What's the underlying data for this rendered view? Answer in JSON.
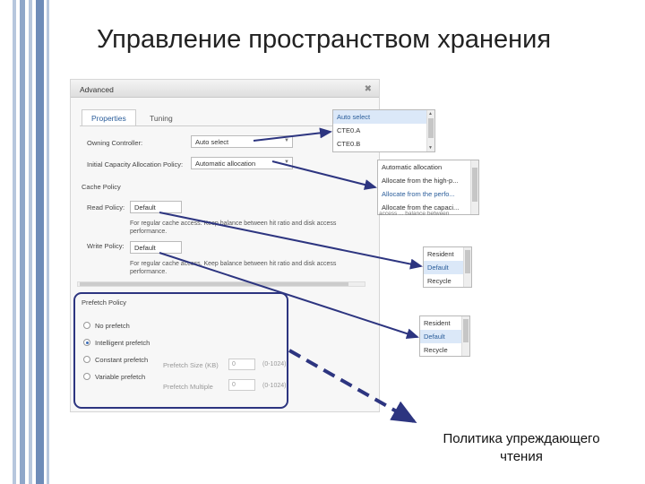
{
  "slide": {
    "title": "Управление пространством хранения",
    "callout": [
      "Политика упреждающего",
      "чтения"
    ]
  },
  "dialog": {
    "title": "Advanced",
    "tabs": [
      {
        "label": "Properties",
        "active": true
      },
      {
        "label": "Tuning",
        "active": false
      }
    ],
    "owning_controller": {
      "label": "Owning Controller:",
      "value": "Auto select"
    },
    "initial_capacity": {
      "label": "Initial Capacity Allocation Policy:",
      "value": "Automatic allocation"
    },
    "cache_policy": {
      "heading": "Cache Policy",
      "read": {
        "label": "Read Policy:",
        "value": "Default",
        "desc": "For regular cache access. Keep balance between hit ratio and disk access performance."
      },
      "write": {
        "label": "Write Policy:",
        "value": "Default",
        "desc": "For regular cache access. Keep balance between hit ratio and disk access performance."
      }
    },
    "prefetch_policy": {
      "heading": "Prefetch Policy",
      "options": [
        "No prefetch",
        "Intelligent prefetch",
        "Constant prefetch",
        "Variable prefetch"
      ],
      "selected": "Intelligent prefetch",
      "size": {
        "label": "Prefetch Size (KB)",
        "value": "0",
        "range": "(0-1024)"
      },
      "multiple": {
        "label": "Prefetch Multiple",
        "value": "0",
        "range": "(0-1024)"
      }
    }
  },
  "dropdowns": {
    "controller": {
      "options": [
        "Auto select",
        "CTE0.A",
        "CTE0.B"
      ],
      "selected": "Auto select"
    },
    "allocation": {
      "options": [
        "Automatic allocation",
        "Allocate from the high-p...",
        "Allocate from the perfo...",
        "Allocate from the capaci..."
      ],
      "highlighted": "Allocate from the perfo...",
      "tail_text": "access ... balance between"
    },
    "read": {
      "options": [
        "Resident",
        "Default",
        "Recycle"
      ],
      "selected": "Default"
    },
    "write": {
      "options": [
        "Resident",
        "Default",
        "Recycle"
      ],
      "selected": "Default"
    }
  },
  "colors": {
    "arrow": "#2d3580",
    "stripe_dark": "#6e8cb8",
    "stripe_light": "#b7c7dd",
    "accent": "#2a5d9a"
  }
}
